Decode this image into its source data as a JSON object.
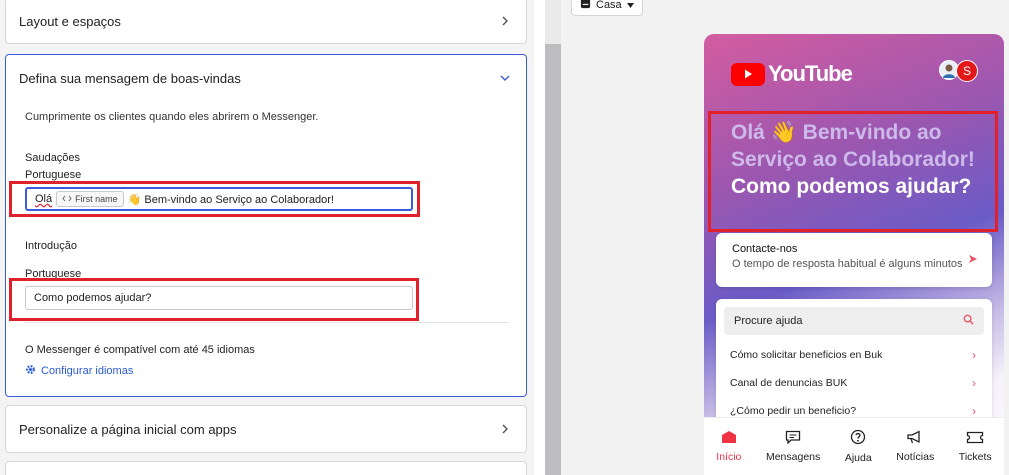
{
  "settings": {
    "layout_title": "Layout e espaços",
    "welcome": {
      "title": "Defina sua mensagem de boas-vindas",
      "description": "Cumprimente os clientes quando eles abrirem o Messenger.",
      "greetings_label": "Saudações",
      "greetings_lang": "Portuguese",
      "greeting_prefix": "Olá",
      "chip_label": "First name",
      "greeting_suffix": "👋 Bem-vindo ao Serviço ao Colaborador!",
      "intro_label": "Introdução",
      "intro_lang": "Portuguese",
      "intro_value": "Como podemos ajudar?",
      "languages_note": "O Messenger é compatível com até 45 idiomas",
      "configure_link": "Configurar idiomas"
    },
    "home_apps_title": "Personalize a página inicial com apps"
  },
  "preview": {
    "audience_select": "Casa",
    "brand": "YouTube",
    "avatar_letter": "S",
    "greeting_line": "Olá 👋 Bem-vindo ao Serviço ao Colaborador!",
    "intro_line": "Como podemos ajudar?",
    "contact_title": "Contacte-nos",
    "contact_subtitle": "O tempo de resposta habitual é alguns minutos",
    "search_label": "Procure ajuda",
    "help_items": [
      "Cómo solicitar beneficios en Buk",
      "Canal de denuncias BUK",
      "¿Cómo pedir un beneficio?"
    ],
    "tabs": [
      "Início",
      "Mensagens",
      "Ajuda",
      "Notícias",
      "Tickets"
    ]
  },
  "colors": {
    "accent_blue": "#3b5bdb",
    "highlight_red": "#e0212b",
    "messenger_accent": "#ee3344",
    "youtube_red": "#ff0000"
  }
}
